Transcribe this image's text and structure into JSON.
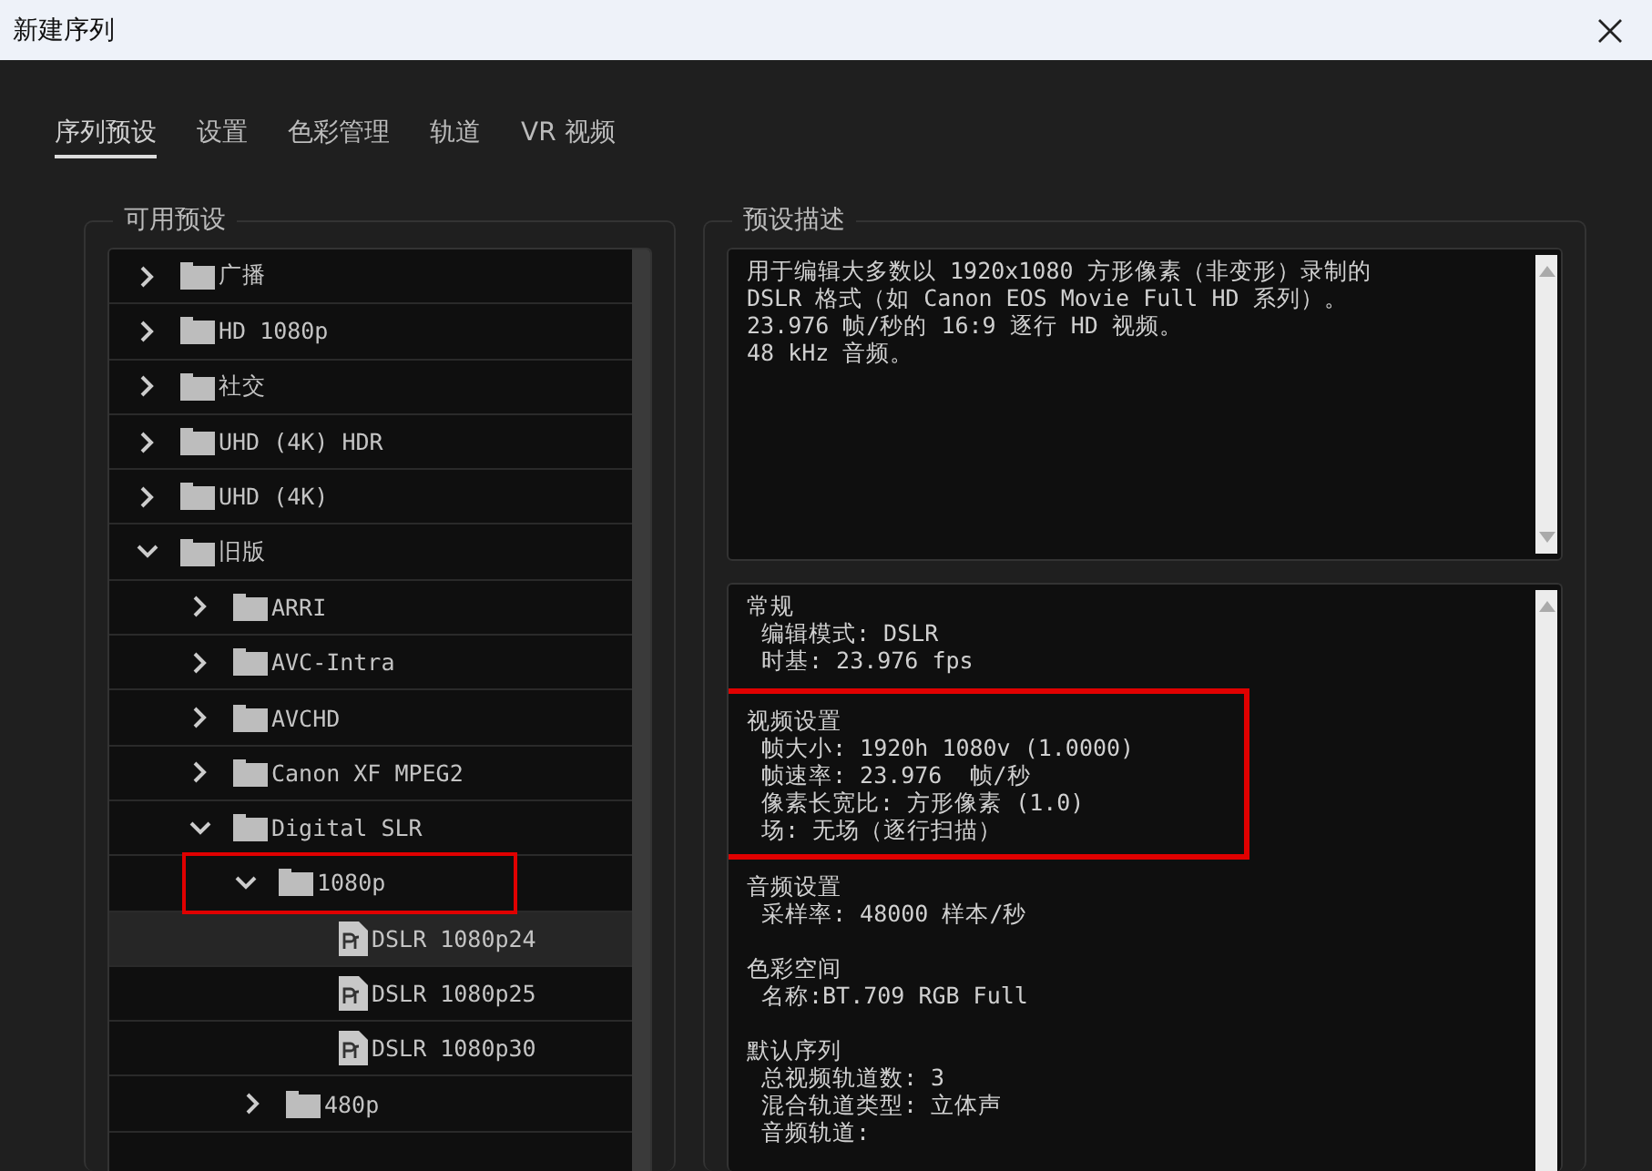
{
  "window": {
    "title": "新建序列"
  },
  "tabs": [
    {
      "label": "序列预设",
      "selected": true
    },
    {
      "label": "设置",
      "selected": false
    },
    {
      "label": "色彩管理",
      "selected": false
    },
    {
      "label": "轨道",
      "selected": false
    },
    {
      "label": "VR 视频",
      "selected": false
    }
  ],
  "presets_panel": {
    "title": "可用预设",
    "tree": [
      {
        "kind": "folder",
        "label": "广播",
        "expanded": false,
        "selected": false,
        "highlighted": false
      },
      {
        "kind": "folder",
        "label": "HD 1080p",
        "expanded": false,
        "selected": false,
        "highlighted": false
      },
      {
        "kind": "folder",
        "label": "社交",
        "expanded": false,
        "selected": false,
        "highlighted": false
      },
      {
        "kind": "folder",
        "label": "UHD (4K) HDR",
        "expanded": false,
        "selected": false,
        "highlighted": false
      },
      {
        "kind": "folder",
        "label": "UHD (4K)",
        "expanded": false,
        "selected": false,
        "highlighted": false
      },
      {
        "kind": "folder",
        "label": "旧版",
        "expanded": true,
        "selected": false,
        "highlighted": false,
        "children": [
          {
            "kind": "folder",
            "label": "ARRI",
            "expanded": false,
            "selected": false,
            "highlighted": false
          },
          {
            "kind": "folder",
            "label": "AVC-Intra",
            "expanded": false,
            "selected": false,
            "highlighted": false
          },
          {
            "kind": "folder",
            "label": "AVCHD",
            "expanded": false,
            "selected": false,
            "highlighted": false
          },
          {
            "kind": "folder",
            "label": "Canon XF MPEG2",
            "expanded": false,
            "selected": false,
            "highlighted": false
          },
          {
            "kind": "folder",
            "label": "Digital SLR",
            "expanded": true,
            "selected": false,
            "highlighted": false,
            "children": [
              {
                "kind": "folder",
                "label": "1080p",
                "expanded": true,
                "selected": false,
                "highlighted": true,
                "children": [
                  {
                    "kind": "preset",
                    "label": "DSLR 1080p24",
                    "selected": true
                  },
                  {
                    "kind": "preset",
                    "label": "DSLR 1080p25",
                    "selected": false
                  },
                  {
                    "kind": "preset",
                    "label": "DSLR 1080p30",
                    "selected": false
                  }
                ]
              },
              {
                "kind": "folder",
                "label": "480p",
                "expanded": false,
                "selected": false,
                "highlighted": false
              }
            ]
          }
        ]
      }
    ]
  },
  "description_panel": {
    "title": "预设描述",
    "lines": [
      "用于编辑大多数以 1920x1080 方形像素（非变形）录制的",
      "DSLR 格式（如 Canon EOS Movie Full HD 系列）。",
      "23.976 帧/秒的 16:9 逐行 HD 视频。",
      "48 kHz 音频。"
    ]
  },
  "details": [
    {
      "heading": "常规",
      "highlighted": false,
      "lines": [
        "编辑模式: DSLR",
        "时基: 23.976 fps"
      ]
    },
    {
      "heading": "视频设置",
      "highlighted": true,
      "lines": [
        "帧大小: 1920h 1080v (1.0000)",
        "帧速率: 23.976  帧/秒",
        "像素长宽比: 方形像素 (1.0)",
        "场: 无场（逐行扫描）"
      ]
    },
    {
      "heading": "音频设置",
      "highlighted": false,
      "lines": [
        "采样率: 48000 样本/秒"
      ]
    },
    {
      "heading": "色彩空间",
      "highlighted": false,
      "lines": [
        "名称:BT.709 RGB Full"
      ]
    },
    {
      "heading": "默认序列",
      "highlighted": false,
      "lines": [
        "总视频轨道数: 3",
        "混合轨道类型: 立体声",
        "音频轨道:"
      ]
    }
  ]
}
